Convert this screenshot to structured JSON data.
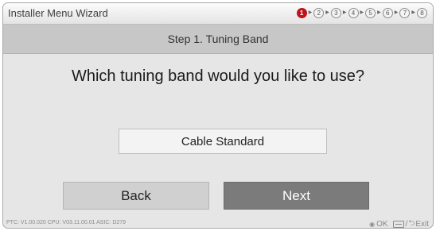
{
  "app_title": "Installer Menu Wizard",
  "steps": [
    "1",
    "2",
    "3",
    "4",
    "5",
    "6",
    "7",
    "8"
  ],
  "active_step": "1",
  "step_title": "Step 1. Tuning Band",
  "question": "Which tuning band would you like to use?",
  "option_value": "Cable Standard",
  "buttons": {
    "back": "Back",
    "next": "Next"
  },
  "footer": {
    "version": "PTC:  V1.00.020 CPU: V03.11.00.01 ASIC: D279",
    "ok_label": "OK",
    "separator": "/",
    "exit_label": "Exit"
  },
  "icons": {
    "ok": "ok-circle-icon",
    "menu": "menu-button-icon",
    "back": "back-arrow-icon"
  },
  "colors": {
    "active_step": "#c0121b",
    "next_button": "#7b7b7b"
  }
}
